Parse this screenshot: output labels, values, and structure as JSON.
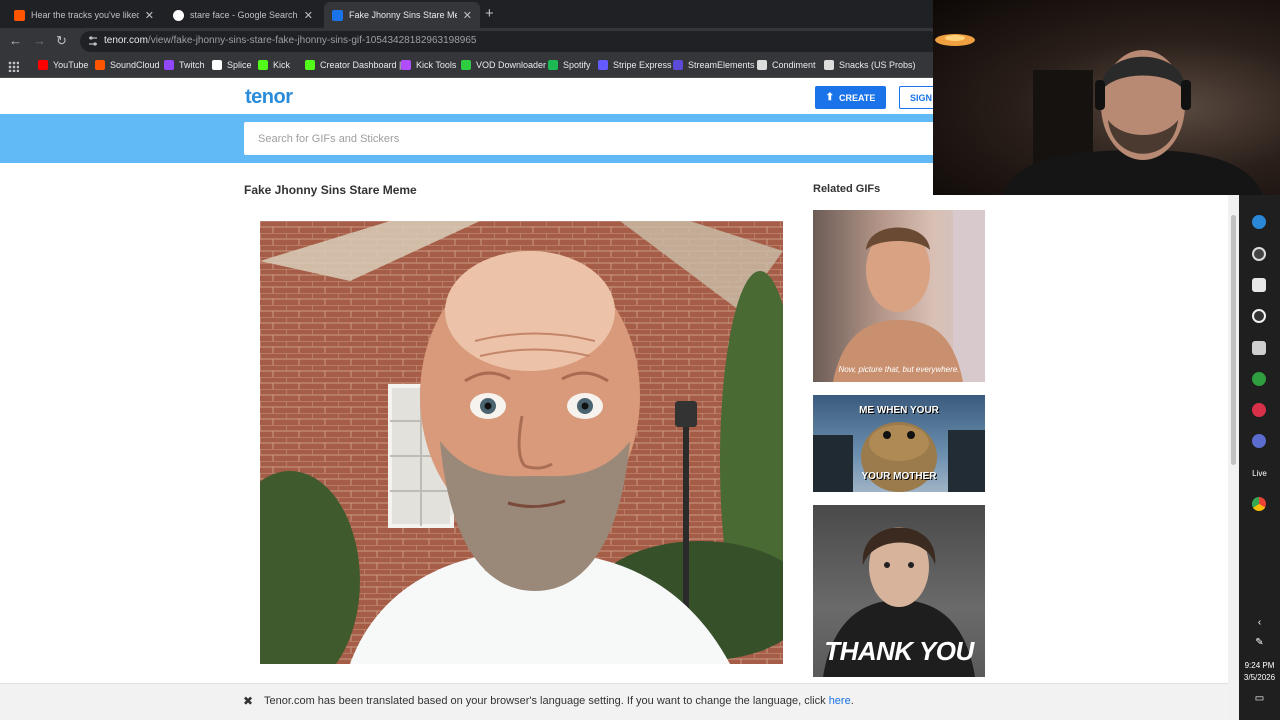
{
  "browser": {
    "tabs": [
      {
        "title": "Hear the tracks you've liked: on",
        "favicon_color": "#ff5500",
        "active": false
      },
      {
        "title": "stare face - Google Search",
        "favicon_color": "#4285f4",
        "active": false
      },
      {
        "title": "Fake Jhonny Sins Stare Meme",
        "favicon_color": "#1a73e8",
        "active": true
      }
    ],
    "url_host": "tenor.com",
    "url_path": "/view/fake-jhonny-sins-stare-fake-jhonny-sins-gif-10543428182963198965",
    "bookmarks": [
      {
        "label": "YouTube",
        "color": "#ff0000"
      },
      {
        "label": "SoundCloud",
        "color": "#ff5500"
      },
      {
        "label": "Twitch",
        "color": "#9146ff"
      },
      {
        "label": "Splice",
        "color": "#ffffff"
      },
      {
        "label": "Kick",
        "color": "#53fc18"
      },
      {
        "label": "Creator Dashboard |...",
        "color": "#53fc18"
      },
      {
        "label": "Kick Tools",
        "color": "#b04dff"
      },
      {
        "label": "VOD Downloader",
        "color": "#2ecc40"
      },
      {
        "label": "Spotify",
        "color": "#1db954"
      },
      {
        "label": "Stripe Express",
        "color": "#635bff"
      },
      {
        "label": "StreamElements",
        "color": "#5c4bd6"
      },
      {
        "label": "Condiment",
        "color": "#dddddd"
      },
      {
        "label": "Snacks (US Probs)",
        "color": "#dddddd"
      }
    ]
  },
  "tenor": {
    "logo": "tenor",
    "create_label": "CREATE",
    "signin_label": "SIGN",
    "search_placeholder": "Search for GIFs and Stickers",
    "gif_title": "Fake Jhonny Sins Stare Meme",
    "related_title": "Related GIFs",
    "related": [
      {
        "caption": "Now, picture that, but everywhere."
      },
      {
        "caption_top": "ME WHEN YOUR",
        "caption_bottom": "YOUR MOTHER"
      },
      {
        "caption": "THANK YOU"
      }
    ],
    "accent_color": "#61baf5"
  },
  "translate_bar": {
    "message": "Tenor.com has been translated based on your browser's language setting. If you want to change the language, click ",
    "link": "here",
    "end": "."
  },
  "taskbar": {
    "live_label": "Live",
    "time": "9:24 PM",
    "date": "3/5/2026"
  }
}
